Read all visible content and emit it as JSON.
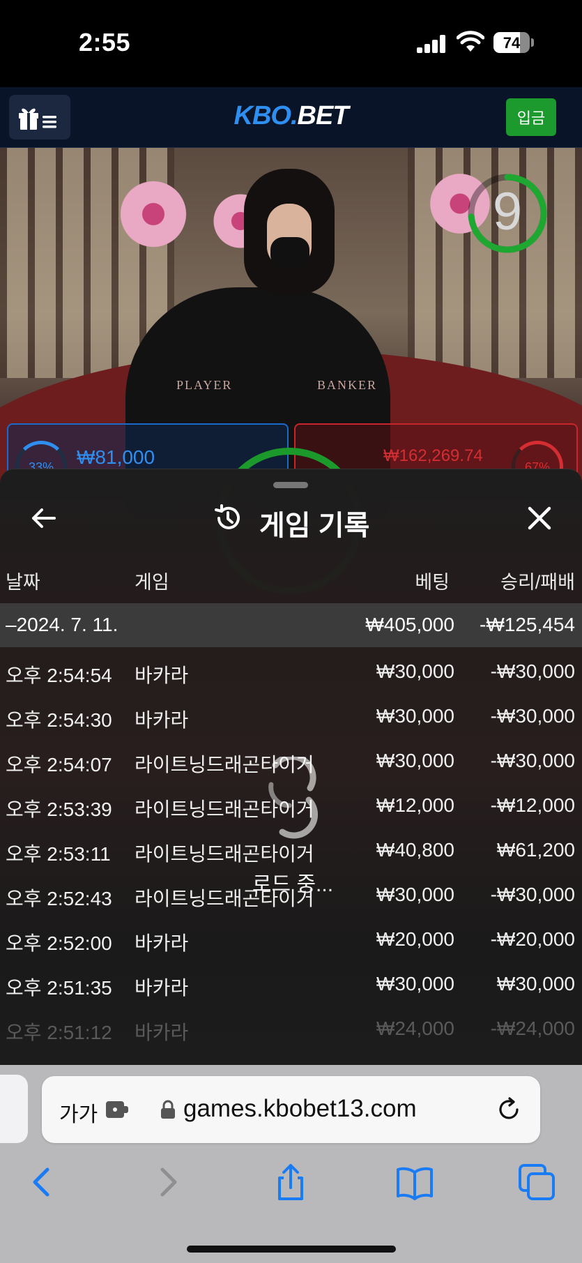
{
  "status_bar": {
    "time": "2:55",
    "battery": "74"
  },
  "site": {
    "logo_part1": "KBO.",
    "logo_part2": "BET",
    "deposit_label": "입금"
  },
  "stream": {
    "timer": "9",
    "table_player": "PLAYER",
    "table_banker": "BANKER",
    "player_pct": "33%",
    "player_amount": "₩81,000",
    "banker_pct": "67%",
    "banker_amount": "₩162,269.74"
  },
  "history": {
    "title": "게임 기록",
    "columns": {
      "date": "날짜",
      "game": "게임",
      "bet": "베팅",
      "result": "승리/패배"
    },
    "date_group": {
      "date": "–2024. 7. 11.",
      "bet": "₩405,000",
      "result": "-₩125,454"
    },
    "rows": [
      {
        "time": "오후 2:54:54",
        "game": "바카라",
        "bet": "₩30,000",
        "result": "-₩30,000"
      },
      {
        "time": "오후 2:54:30",
        "game": "바카라",
        "bet": "₩30,000",
        "result": "-₩30,000"
      },
      {
        "time": "오후 2:54:07",
        "game": "라이트닝드래곤타이거",
        "bet": "₩30,000",
        "result": "-₩30,000"
      },
      {
        "time": "오후 2:53:39",
        "game": "라이트닝드래곤타이거",
        "bet": "₩12,000",
        "result": "-₩12,000"
      },
      {
        "time": "오후 2:53:11",
        "game": "라이트닝드래곤타이거",
        "bet": "₩40,800",
        "result": "₩61,200"
      },
      {
        "time": "오후 2:52:43",
        "game": "라이트닝드래곤타이거",
        "bet": "₩30,000",
        "result": "-₩30,000"
      },
      {
        "time": "오후 2:52:00",
        "game": "바카라",
        "bet": "₩20,000",
        "result": "-₩20,000"
      },
      {
        "time": "오후 2:51:35",
        "game": "바카라",
        "bet": "₩30,000",
        "result": "₩30,000"
      },
      {
        "time": "오후 2:51:12",
        "game": "바카라",
        "bet": "₩24,000",
        "result": "-₩24,000"
      }
    ],
    "loading_text": "로드 중..."
  },
  "browser": {
    "text_size_label": "가가",
    "url": "games.kbobet13.com"
  },
  "colors": {
    "accent_blue": "#2f8ff0",
    "banker_red": "#d42e33",
    "deposit_green": "#1c9a2d",
    "ios_blue": "#1a7cf5"
  }
}
